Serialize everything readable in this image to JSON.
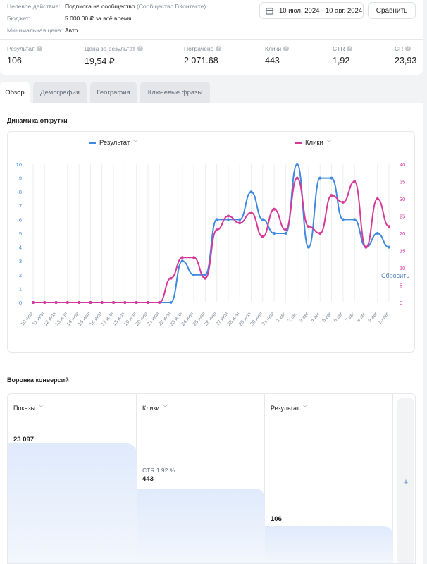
{
  "info": {
    "goal_label": "Целевое действие:",
    "goal_value": "Подписка на сообщество",
    "goal_extra": "(Сообщество ВКонтакте)",
    "budget_label": "Бюджет:",
    "budget_value": "5 000.00 ₽ за всё время",
    "min_price_label": "Минимальная цена:",
    "min_price_value": "Авто"
  },
  "date_range": "10 июл. 2024 - 10 авг. 2024",
  "compare_label": "Сравнить",
  "stats": [
    {
      "label": "Результат",
      "value": "106"
    },
    {
      "label": "Цена за результат",
      "value": "19,54 ₽"
    },
    {
      "label": "Потрачено",
      "value": "2 071.68"
    },
    {
      "label": "Клики",
      "value": "443"
    },
    {
      "label": "CTR",
      "value": "1,92"
    },
    {
      "label": "CR",
      "value": "23,93"
    }
  ],
  "tabs": [
    "Обзор",
    "Демография",
    "География",
    "Ключевые фразы"
  ],
  "chart_title": "Динамика открутки",
  "colors": {
    "result": "#3f8ae0",
    "clicks": "#d6399a",
    "accent": "#5181b8"
  },
  "chart_data": {
    "type": "line",
    "categories": [
      "10 июл",
      "11 июл",
      "12 июл",
      "13 июл",
      "14 июл",
      "15 июл",
      "16 июл",
      "17 июл",
      "18 июл",
      "19 июл",
      "20 июл",
      "21 июл",
      "22 июл",
      "23 июл",
      "24 июл",
      "25 июл",
      "26 июл",
      "27 июл",
      "28 июл",
      "29 июл",
      "30 июл",
      "31 июл",
      "1 авг",
      "2 авг",
      "3 авг",
      "4 авг",
      "5 авг",
      "6 авг",
      "7 авг",
      "8 авг",
      "9 авг",
      "10 авг"
    ],
    "series": [
      {
        "name": "Результат",
        "axis": "left",
        "values": [
          0,
          0,
          0,
          0,
          0,
          0,
          0,
          0,
          0,
          0,
          0,
          0,
          0,
          3,
          2,
          2,
          6,
          6,
          6,
          8,
          6,
          5,
          5,
          10,
          4,
          9,
          9,
          6,
          6,
          4,
          5,
          4
        ]
      },
      {
        "name": "Клики",
        "axis": "right",
        "values": [
          0,
          0,
          0,
          0,
          0,
          0,
          0,
          0,
          0,
          0,
          0,
          0,
          7,
          13,
          13,
          7,
          21,
          25,
          23,
          26,
          19,
          27,
          21,
          36,
          22,
          20,
          31,
          29,
          35,
          16,
          30,
          22
        ]
      }
    ],
    "y_left": {
      "min": 0,
      "max": 10,
      "ticks": [
        "0",
        "1",
        "2",
        "3",
        "4",
        "5",
        "6",
        "7",
        "8",
        "9",
        "10"
      ]
    },
    "y_right": {
      "min": 0,
      "max": 40,
      "ticks": [
        "0",
        "5",
        "10",
        "15",
        "20",
        "25",
        "30",
        "35",
        "40"
      ]
    },
    "grid": "vertical",
    "legend": "top"
  },
  "funnel": {
    "title": "Воронка конверсий",
    "reset_label": "Сбросить",
    "columns": [
      {
        "header": "Показы",
        "value": "23 097",
        "fill": 1.0
      },
      {
        "header": "Клики",
        "value": "443",
        "ctr": "CTR 1.92 %",
        "fill": 0.63
      },
      {
        "header": "Результат",
        "value": "106",
        "fill": 0.32
      }
    ],
    "add_label": "+"
  }
}
